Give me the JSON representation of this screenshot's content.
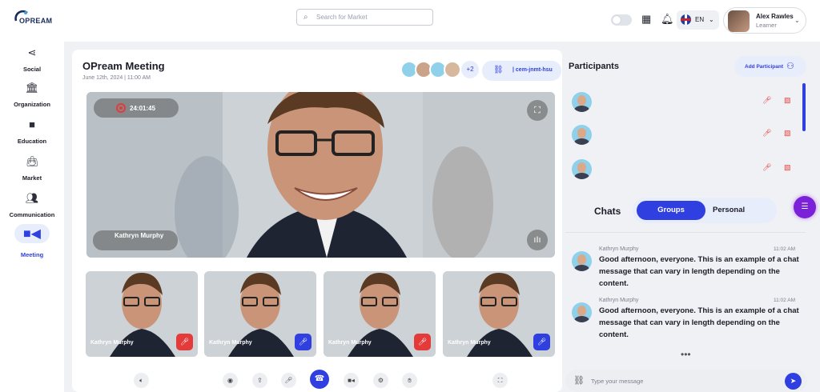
{
  "brand": {
    "name": "OPREAM"
  },
  "search": {
    "placeholder": "Search for Market"
  },
  "header": {
    "lang": "EN",
    "user_name": "Alex Rawles",
    "user_role": "Learner"
  },
  "sidebar": {
    "items": [
      {
        "label": "Social",
        "icon": "share-icon"
      },
      {
        "label": "Organization",
        "icon": "bank-icon"
      },
      {
        "label": "Education",
        "icon": "book-icon"
      },
      {
        "label": "Market",
        "icon": "bag-icon"
      },
      {
        "label": "Communication",
        "icon": "people-icon"
      },
      {
        "label": "Meeting",
        "icon": "video-icon"
      }
    ]
  },
  "meeting": {
    "title": "OPream Meeting",
    "date": "June 12th, 2024 | 11:00 AM",
    "extra_count": "+2",
    "link_code": "cem-jnmt-hsu",
    "timer": "24:01:45",
    "speaker_name": "Kathryn Murphy",
    "thumbs": [
      {
        "name": "Kathryn Murphy",
        "muted": true
      },
      {
        "name": "Kathryn Murphy",
        "muted": false
      },
      {
        "name": "Kathryn Murphy",
        "muted": true
      },
      {
        "name": "Kathryn Murphy",
        "muted": false
      }
    ]
  },
  "participants": {
    "title": "Participants",
    "add_label": "Add Participant"
  },
  "chats": {
    "label": "Chats",
    "tabs": [
      "Groups",
      "Personal"
    ],
    "input_placeholder": "Type your message",
    "messages": [
      {
        "sender": "Kathryn Murphy",
        "time": "11:02 AM",
        "text": "Good afternoon, everyone. This is an example of a chat message that can vary in length depending on the content."
      },
      {
        "sender": "Kathryn Murphy",
        "time": "11:02 AM",
        "text": "Good afternoon, everyone. This is an example of a chat message that can vary in length depending on the content."
      }
    ],
    "more": "•••"
  },
  "colors": {
    "accent": "#2f3fe0",
    "muted_red": "#e43a3a",
    "fab": "#7b22d8"
  }
}
